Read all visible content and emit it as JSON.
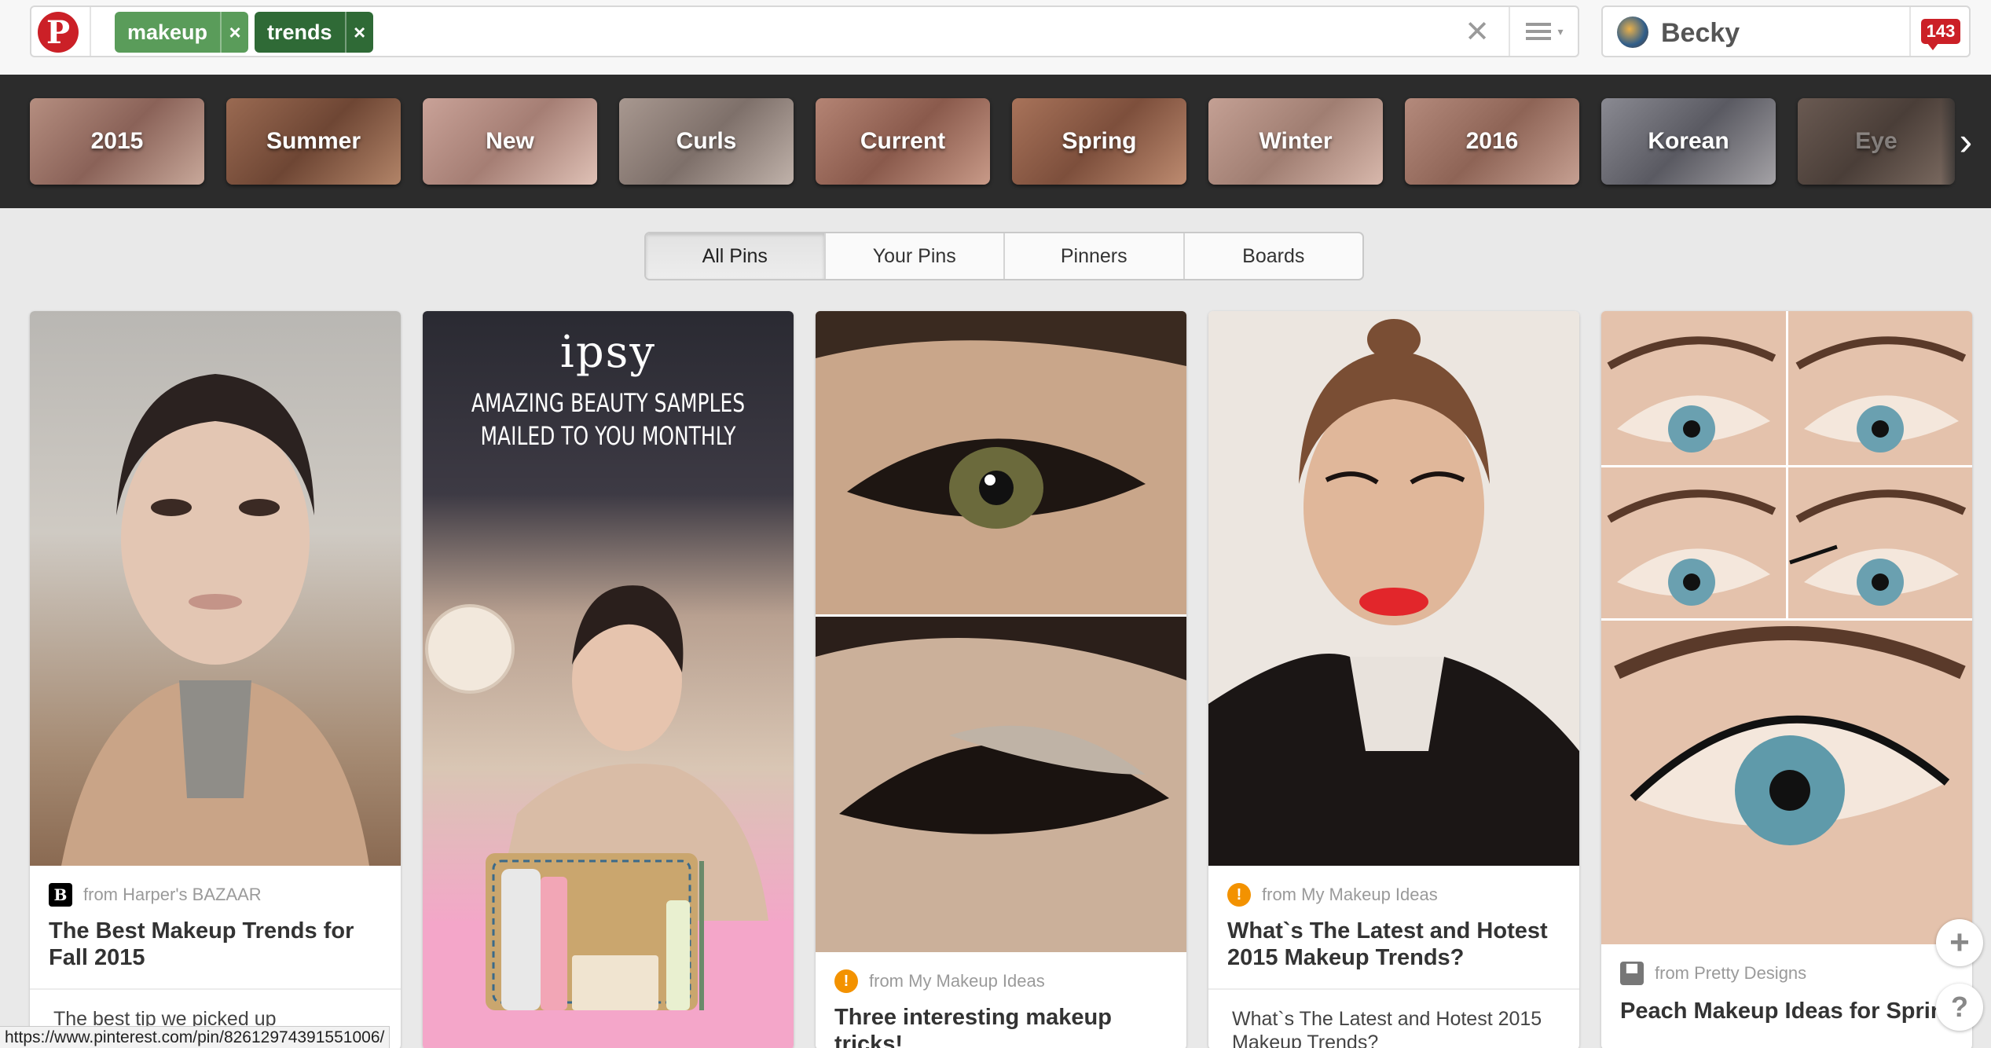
{
  "search": {
    "tags": [
      {
        "label": "makeup",
        "color": "#5a9c5a"
      },
      {
        "label": "trends",
        "color": "#2f6a36"
      }
    ],
    "clear_glyph": "✕",
    "tag_remove_glyph": "×"
  },
  "user": {
    "name": "Becky",
    "notifications": "143"
  },
  "guides": [
    "2015",
    "Summer",
    "New",
    "Curls",
    "Current",
    "Spring",
    "Winter",
    "2016",
    "Korean",
    "Eye"
  ],
  "filter_tabs": [
    "All Pins",
    "Your Pins",
    "Pinners",
    "Boards"
  ],
  "pins": [
    {
      "source": "from Harper's BAZAAR",
      "source_icon": "B",
      "title": "The Best Makeup Trends for Fall 2015",
      "description": "The best tip we picked up"
    },
    {
      "brand": "ipsy",
      "headline_line1": "AMAZING BEAUTY SAMPLES",
      "headline_line2": "MAILED TO YOU MONTHLY"
    },
    {
      "source": "from My Makeup Ideas",
      "title": "Three interesting makeup tricks!"
    },
    {
      "source": "from My Makeup Ideas",
      "title": "What`s The Latest and Hotest 2015 Makeup Trends?",
      "description": "What`s The Latest and Hotest 2015 Makeup Trends?"
    },
    {
      "source": "from Pretty Designs",
      "title": "Peach Makeup Ideas for Spring"
    }
  ],
  "status_url": "https://www.pinterest.com/pin/82612974391551006/",
  "colors": {
    "brand_red": "#cb2027",
    "guide_bar": "#2c2c2c",
    "background": "#e9e9e9"
  }
}
